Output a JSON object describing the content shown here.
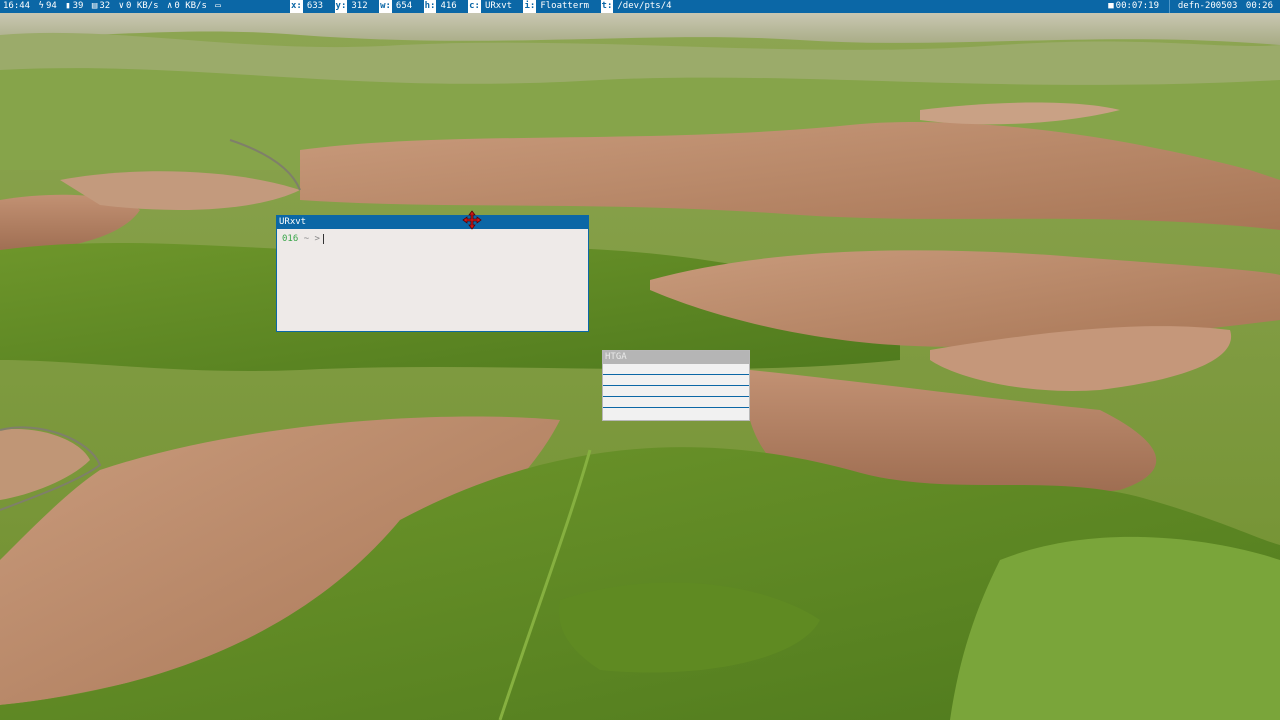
{
  "topbar": {
    "time": "16:44",
    "battery": "94",
    "memory": "39",
    "cpu": "32",
    "down_speed": "0 KB/s",
    "up_speed": "0 KB/s",
    "fields": [
      {
        "key": "x:",
        "value": "633"
      },
      {
        "key": "y:",
        "value": "312"
      },
      {
        "key": "w:",
        "value": "654"
      },
      {
        "key": "h:",
        "value": "416"
      },
      {
        "key": "c:",
        "value": "URxvt"
      },
      {
        "key": "i:",
        "value": "Floatterm"
      },
      {
        "key": "t:",
        "value": "/dev/pts/4"
      }
    ],
    "timer": "00:07:19",
    "host": "defn-200503",
    "clock": "00:26"
  },
  "windows": {
    "urxvt": {
      "title": "URxvt",
      "prompt_number": "016",
      "prompt_path": "~",
      "prompt_symbol": ">"
    },
    "htga": {
      "title": "HTGA"
    }
  },
  "colors": {
    "accent": "#0b67a6",
    "terminal_bg": "#eeeae8",
    "prompt_green": "#3aa64a",
    "inactive_title": "#b5b5b5"
  },
  "icons": {
    "battery": "lightning-icon",
    "memory": "memory-icon",
    "cpu": "cpu-icon",
    "download": "download-arrow-icon",
    "upload": "upload-arrow-icon",
    "display": "display-icon",
    "recording": "camera-icon",
    "move_cursor": "move-cursor-icon"
  }
}
